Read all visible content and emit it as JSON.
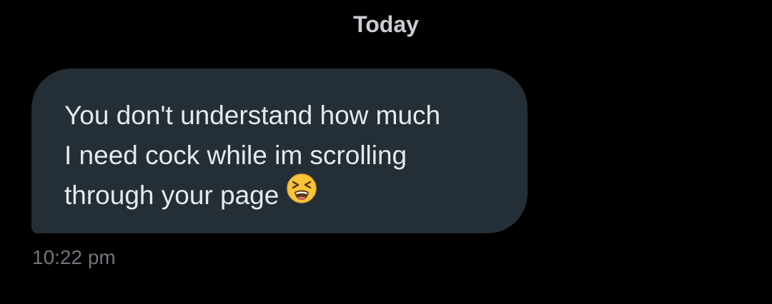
{
  "thread": {
    "date_divider": "Today",
    "message": {
      "text": "You don't understand how much\nI need cock while im scrolling\nthrough your page",
      "emoji": "tired-face-icon",
      "timestamp": "10:22 pm"
    }
  },
  "colors": {
    "background": "#000000",
    "bubble": "#242e36",
    "message_text": "#e7e9ea",
    "date_text": "#c9cdd1",
    "timestamp_text": "#71767b",
    "emoji_face": "#f8c53a"
  }
}
